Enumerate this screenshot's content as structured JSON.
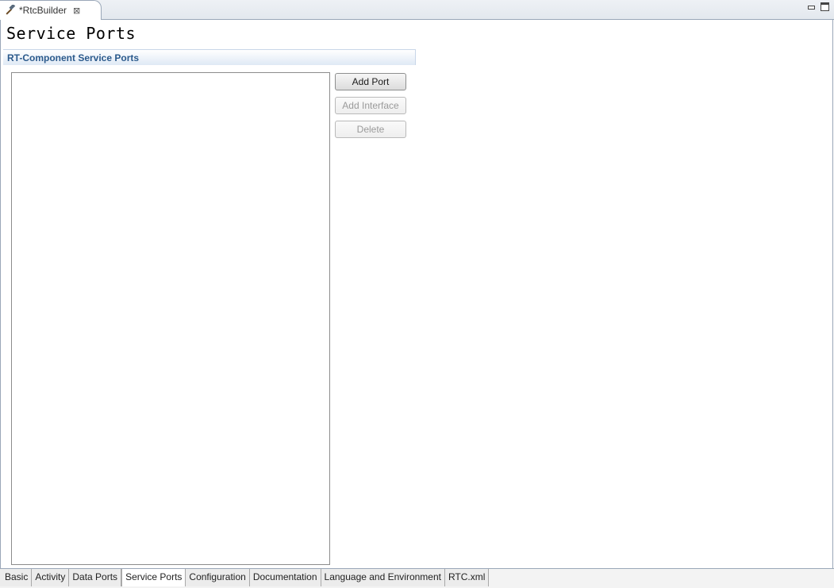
{
  "editor": {
    "tab_title": "*RtcBuilder",
    "close_glyph": "⊠",
    "icon": "hammer-icon"
  },
  "window_controls": {
    "minimize_icon": "minimize-icon",
    "maximize_icon": "maximize-icon"
  },
  "page": {
    "title": "Service Ports"
  },
  "section": {
    "title": "RT-Component Service Ports"
  },
  "ports_list": {
    "items": []
  },
  "buttons": {
    "add_port": "Add Port",
    "add_interface": "Add Interface",
    "delete": "Delete"
  },
  "page_tabs": {
    "items": [
      {
        "label": "Basic"
      },
      {
        "label": "Activity"
      },
      {
        "label": "Data Ports"
      },
      {
        "label": "Service Ports"
      },
      {
        "label": "Configuration"
      },
      {
        "label": "Documentation"
      },
      {
        "label": "Language and Environment"
      },
      {
        "label": "RTC.xml"
      }
    ],
    "active": "Service Ports"
  },
  "colors": {
    "section_title": "#2b5a8c",
    "frame_border": "#9aa7b8"
  }
}
